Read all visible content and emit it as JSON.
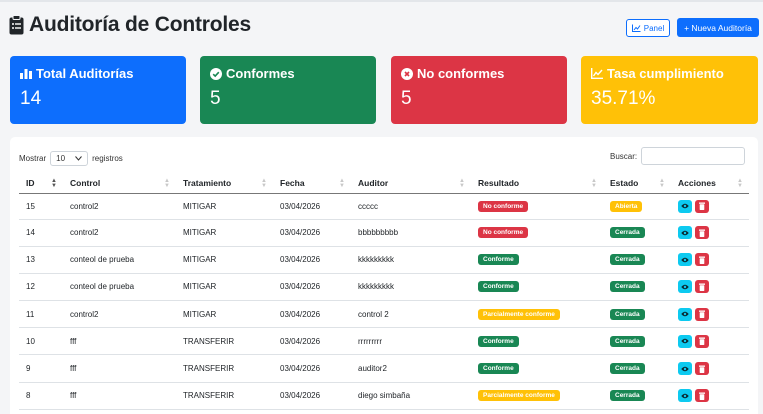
{
  "page": {
    "title": "Auditoría de Controles",
    "title_icon": "clipboard-icon",
    "panel_button": "Panel",
    "new_button": "+ Nueva Auditoría"
  },
  "cards": [
    {
      "label": "Total Auditorías",
      "value": "14",
      "icon": "bar-chart-icon",
      "color": "#0d6efd"
    },
    {
      "label": "Conformes",
      "value": "5",
      "icon": "check-circle-icon",
      "color": "#198754"
    },
    {
      "label": "No conformes",
      "value": "5",
      "icon": "x-circle-icon",
      "color": "#dc3545"
    },
    {
      "label": "Tasa cumplimiento",
      "value": "35.71%",
      "icon": "line-chart-icon",
      "color": "#ffc107"
    }
  ],
  "table_controls": {
    "show_label": "Mostrar",
    "page_length": "10",
    "records_label": "registros",
    "search_label": "Buscar:"
  },
  "columns": [
    "ID",
    "Control",
    "Tratamiento",
    "Fecha",
    "Auditor",
    "Resultado",
    "Estado",
    "Acciones"
  ],
  "rows": [
    {
      "id": "15",
      "control": "control2",
      "tratamiento": "MITIGAR",
      "fecha": "03/04/2026",
      "auditor": "ccccc",
      "resultado": "No conforme",
      "resultado_color": "red",
      "estado": "Abierta",
      "estado_color": "yellow"
    },
    {
      "id": "14",
      "control": "control2",
      "tratamiento": "MITIGAR",
      "fecha": "03/04/2026",
      "auditor": "bbbbbbbbb",
      "resultado": "No conforme",
      "resultado_color": "red",
      "estado": "Cerrada",
      "estado_color": "green"
    },
    {
      "id": "13",
      "control": "conteol de prueba",
      "tratamiento": "MITIGAR",
      "fecha": "03/04/2026",
      "auditor": "kkkkkkkkk",
      "resultado": "Conforme",
      "resultado_color": "green",
      "estado": "Cerrada",
      "estado_color": "green"
    },
    {
      "id": "12",
      "control": "conteol de prueba",
      "tratamiento": "MITIGAR",
      "fecha": "03/04/2026",
      "auditor": "kkkkkkkkk",
      "resultado": "Conforme",
      "resultado_color": "green",
      "estado": "Cerrada",
      "estado_color": "green"
    },
    {
      "id": "11",
      "control": "control2",
      "tratamiento": "MITIGAR",
      "fecha": "03/04/2026",
      "auditor": "control 2",
      "resultado": "Parcialmente conforme",
      "resultado_color": "yellow",
      "estado": "Cerrada",
      "estado_color": "green"
    },
    {
      "id": "10",
      "control": "fff",
      "tratamiento": "TRANSFERIR",
      "fecha": "03/04/2026",
      "auditor": "rrrrrrrrr",
      "resultado": "Conforme",
      "resultado_color": "green",
      "estado": "Cerrada",
      "estado_color": "green"
    },
    {
      "id": "9",
      "control": "fff",
      "tratamiento": "TRANSFERIR",
      "fecha": "03/04/2026",
      "auditor": "auditor2",
      "resultado": "Conforme",
      "resultado_color": "green",
      "estado": "Cerrada",
      "estado_color": "green"
    },
    {
      "id": "8",
      "control": "fff",
      "tratamiento": "TRANSFERIR",
      "fecha": "03/04/2026",
      "auditor": "diego simbaña",
      "resultado": "Parcialmente conforme",
      "resultado_color": "yellow",
      "estado": "Cerrada",
      "estado_color": "green"
    }
  ],
  "action_icons": [
    "eye-icon",
    "trash-icon"
  ]
}
